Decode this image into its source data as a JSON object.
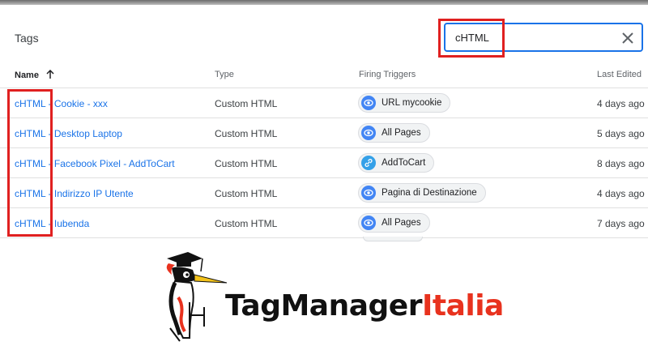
{
  "panel": {
    "title": "Tags",
    "search": {
      "value": "cHTML"
    }
  },
  "table": {
    "headers": {
      "name": "Name",
      "type": "Type",
      "triggers": "Firing Triggers",
      "last_edited": "Last Edited"
    },
    "rows": [
      {
        "name": "cHTML - Cookie - xxx",
        "type": "Custom HTML",
        "trigger": "URL mycookie",
        "trigger_icon": "eye-icon",
        "edited": "4 days ago"
      },
      {
        "name": "cHTML - Desktop Laptop",
        "type": "Custom HTML",
        "trigger": "All Pages",
        "trigger_icon": "eye-icon",
        "edited": "5 days ago"
      },
      {
        "name": "cHTML - Facebook Pixel - AddToCart",
        "type": "Custom HTML",
        "trigger": "AddToCart",
        "trigger_icon": "link-icon",
        "edited": "8 days ago"
      },
      {
        "name": "cHTML - Indirizzo IP Utente",
        "type": "Custom HTML",
        "trigger": "Pagina di Destinazione",
        "trigger_icon": "eye-icon",
        "edited": "4 days ago"
      },
      {
        "name": "cHTML - Iubenda",
        "type": "Custom HTML",
        "trigger": "All Pages",
        "trigger_icon": "eye-icon",
        "edited": "7 days ago"
      }
    ]
  },
  "branding": {
    "logo_text_dark": "TagManager",
    "logo_text_red": "Italia"
  },
  "colors": {
    "link_blue": "#1a73e8",
    "highlight_red": "#e02020",
    "eye_icon_blue": "#4285f4",
    "brand_red": "#e8321e"
  }
}
